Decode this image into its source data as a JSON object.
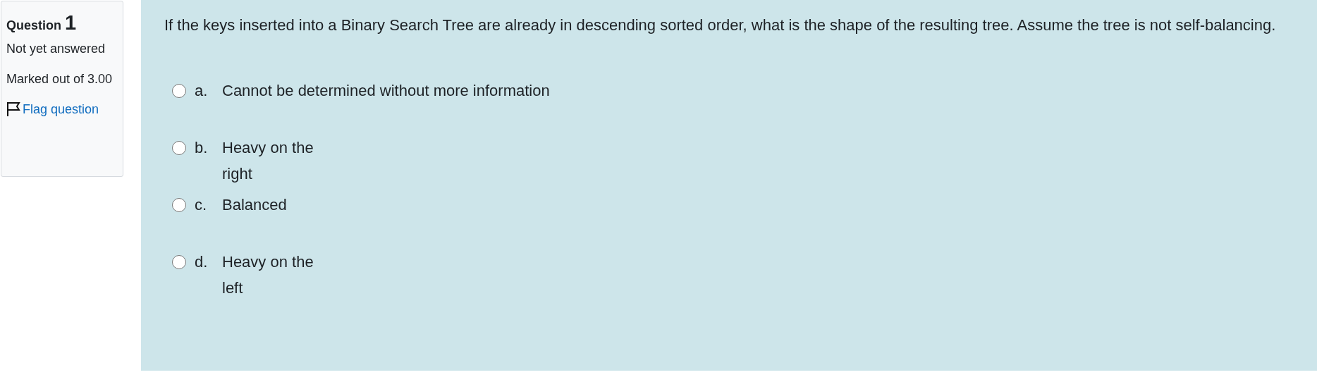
{
  "info": {
    "label": "Question",
    "number": "1",
    "status": "Not yet answered",
    "marks": "Marked out of 3.00",
    "flag": {
      "label": "Flag question",
      "flagged": false
    }
  },
  "question": {
    "text": "If the keys inserted into a Binary Search Tree are already in descending sorted order, what is the shape of the resulting tree. Assume the tree is not self-balancing.",
    "options": [
      {
        "letter": "a.",
        "lines": [
          "Cannot be determined without more information"
        ],
        "selected": false
      },
      {
        "letter": "b.",
        "lines": [
          "Heavy on the",
          "right"
        ],
        "selected": false
      },
      {
        "letter": "c.",
        "lines": [
          "Balanced"
        ],
        "selected": false
      },
      {
        "letter": "d.",
        "lines": [
          "Heavy on the",
          "left"
        ],
        "selected": false
      }
    ]
  }
}
